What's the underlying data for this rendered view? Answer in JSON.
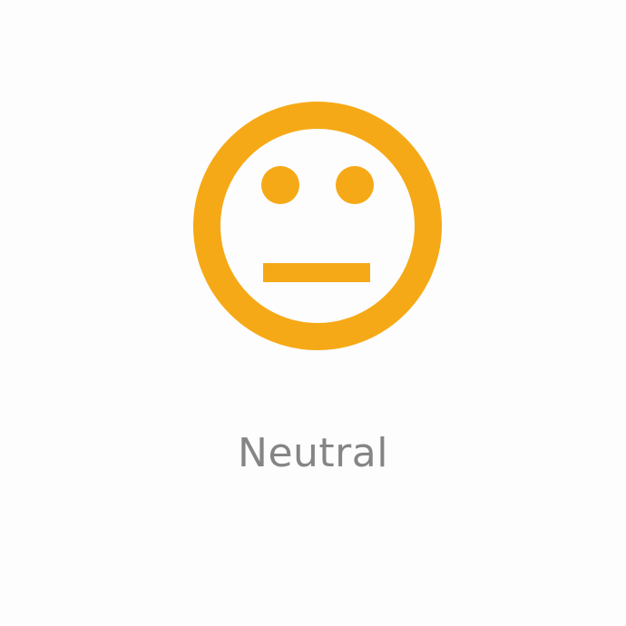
{
  "mood": {
    "label": "Neutral",
    "icon": "neutral-face-icon",
    "accent_color": "#F6A916",
    "label_color": "#858585"
  }
}
